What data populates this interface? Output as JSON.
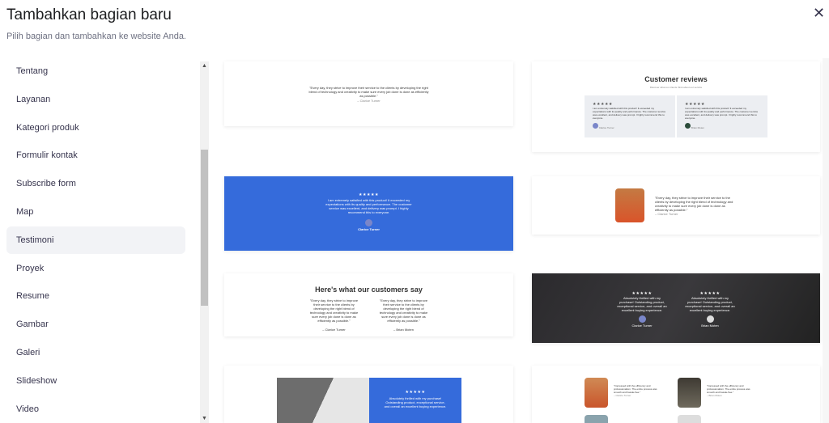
{
  "header": {
    "title": "Tambahkan bagian baru",
    "subtitle": "Pilih bagian dan tambahkan ke website Anda.",
    "close_icon": "close-icon"
  },
  "sidebar": {
    "items": [
      {
        "label": "Tentang"
      },
      {
        "label": "Layanan"
      },
      {
        "label": "Kategori produk"
      },
      {
        "label": "Formulir kontak"
      },
      {
        "label": "Subscribe form"
      },
      {
        "label": "Map"
      },
      {
        "label": "Testimoni",
        "active": true
      },
      {
        "label": "Proyek"
      },
      {
        "label": "Resume"
      },
      {
        "label": "Gambar"
      },
      {
        "label": "Galeri"
      },
      {
        "label": "Slideshow"
      },
      {
        "label": "Video"
      }
    ]
  },
  "previews": {
    "quote": "\"Every day, they strive to improve their service to the clients by developing the right blend of technology and creativity to make sure every job done is done as efficiently as possible.\"",
    "author1": "– Clarice Turner",
    "author2": "– Brian Moten",
    "name1": "Clarice Turner",
    "name2": "Brian Moten",
    "stars": "★★★★★",
    "review": "I am extremely satisfied with this product! It exceeded my expectations with its quality and performance. The customer service was excellent, and delivery was prompt. I highly recommend this to everyone.",
    "reviews_title": "Customer reviews",
    "reviews_sub": "Discover what our clients think about our service",
    "say_title": "Here's what our customers say",
    "thrilled": "Absolutely thrilled with my purchase! Outstanding product, exceptional service, and overall an excellent buying experience.",
    "impressed": "\"Impressed with the efficiency and professionalism. The entire process was smooth and hassle-free.\""
  }
}
